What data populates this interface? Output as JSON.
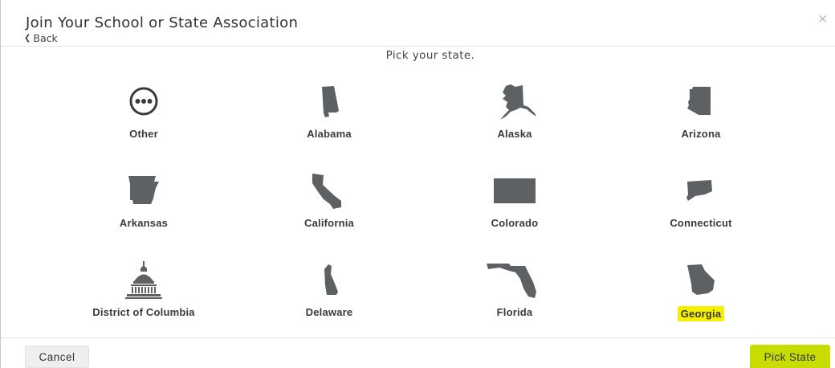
{
  "dialog": {
    "title": "Join Your School or State Association",
    "back_label": "Back",
    "close_glyph": "×",
    "subtitle": "Pick your state."
  },
  "states": [
    {
      "label": "Other",
      "icon": "more-options-icon"
    },
    {
      "label": "Alabama",
      "icon": "alabama-map-icon"
    },
    {
      "label": "Alaska",
      "icon": "alaska-map-icon"
    },
    {
      "label": "Arizona",
      "icon": "arizona-map-icon"
    },
    {
      "label": "Arkansas",
      "icon": "arkansas-map-icon"
    },
    {
      "label": "California",
      "icon": "california-map-icon"
    },
    {
      "label": "Colorado",
      "icon": "colorado-map-icon"
    },
    {
      "label": "Connecticut",
      "icon": "connecticut-map-icon"
    },
    {
      "label": "District of Columbia",
      "icon": "capitol-building-icon"
    },
    {
      "label": "Delaware",
      "icon": "delaware-map-icon"
    },
    {
      "label": "Florida",
      "icon": "florida-map-icon"
    },
    {
      "label": "Georgia",
      "icon": "georgia-map-icon",
      "selected": true
    }
  ],
  "footer": {
    "cancel_label": "Cancel",
    "pick_label": "Pick State"
  },
  "colors": {
    "icon_fill": "#5e6164",
    "highlight": "#f4f000",
    "primary_button": "#c8dc00"
  }
}
